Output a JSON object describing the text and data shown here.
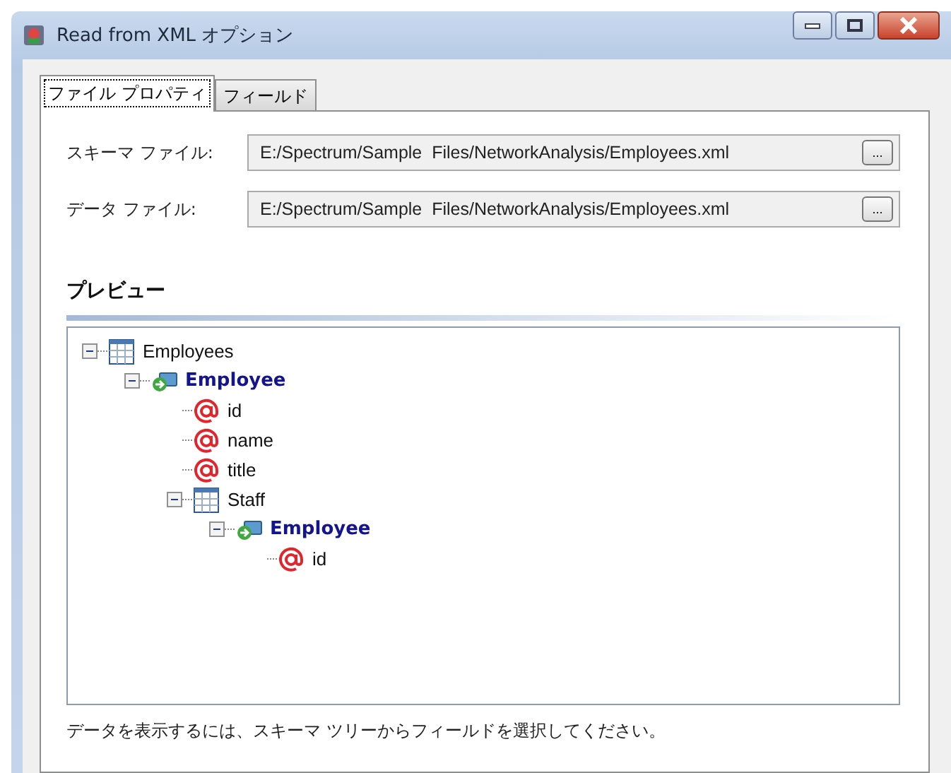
{
  "window": {
    "title": "Read from XML オプション"
  },
  "tabs": [
    {
      "label": "ファイル プロパティ",
      "selected": true
    },
    {
      "label": "フィールド",
      "selected": false
    }
  ],
  "fields": [
    {
      "label": "スキーマ ファイル:",
      "value": "E:/Spectrum/Sample  Files/NetworkAnalysis/Employees.xml",
      "button": "..."
    },
    {
      "label": "データ ファイル:",
      "value": "E:/Spectrum/Sample  Files/NetworkAnalysis/Employees.xml",
      "button": "..."
    }
  ],
  "preview": {
    "heading": "プレビュー",
    "tree": [
      {
        "label": "Employees",
        "kind": "table",
        "expanded": true,
        "children": [
          {
            "label": "Employee",
            "kind": "element",
            "expanded": true,
            "children": [
              {
                "label": "id",
                "kind": "attribute"
              },
              {
                "label": "name",
                "kind": "attribute"
              },
              {
                "label": "title",
                "kind": "attribute"
              },
              {
                "label": "Staff",
                "kind": "table",
                "expanded": true,
                "children": [
                  {
                    "label": "Employee",
                    "kind": "element",
                    "expanded": true,
                    "children": [
                      {
                        "label": "id",
                        "kind": "attribute"
                      }
                    ]
                  }
                ]
              }
            ]
          }
        ]
      }
    ]
  },
  "hint": "データを表示するには、スキーマ ツリーからフィールドを選択してください。"
}
